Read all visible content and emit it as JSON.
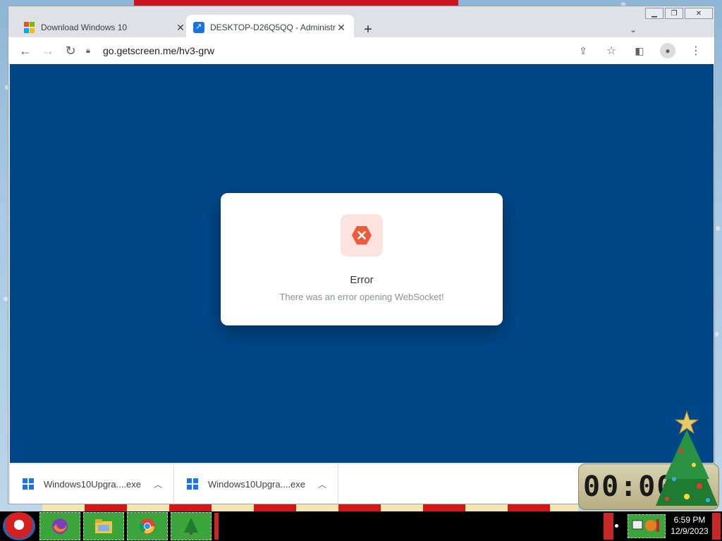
{
  "browser": {
    "tabs": [
      {
        "title": "Download Windows 10",
        "active": false,
        "favicon": "microsoft-logo-icon"
      },
      {
        "title": "DESKTOP-D26Q5QQ - Administr",
        "active": true,
        "favicon": "remote-desktop-icon"
      }
    ],
    "new_tab_label": "+",
    "url": "go.getscreen.me/hv3-grw",
    "window_controls": [
      "minimize",
      "restore",
      "close"
    ]
  },
  "dialog": {
    "title": "Error",
    "message": "There was an error opening WebSocket!",
    "icon": "error-hexagon-icon",
    "accent_color": "#f05a3c",
    "badge_bg": "#fde3df"
  },
  "viewport_bg": "#004788",
  "downloads": [
    {
      "filename": "Windows10Upgra....exe"
    },
    {
      "filename": "Windows10Upgra....exe"
    }
  ],
  "clock_gadget": {
    "display": "00:00"
  },
  "taskbar": {
    "apps": [
      "firefox-icon",
      "file-explorer-icon",
      "chrome-icon",
      "christmas-tree-icon"
    ],
    "time": "6:59 PM",
    "date": "12/9/2023"
  }
}
